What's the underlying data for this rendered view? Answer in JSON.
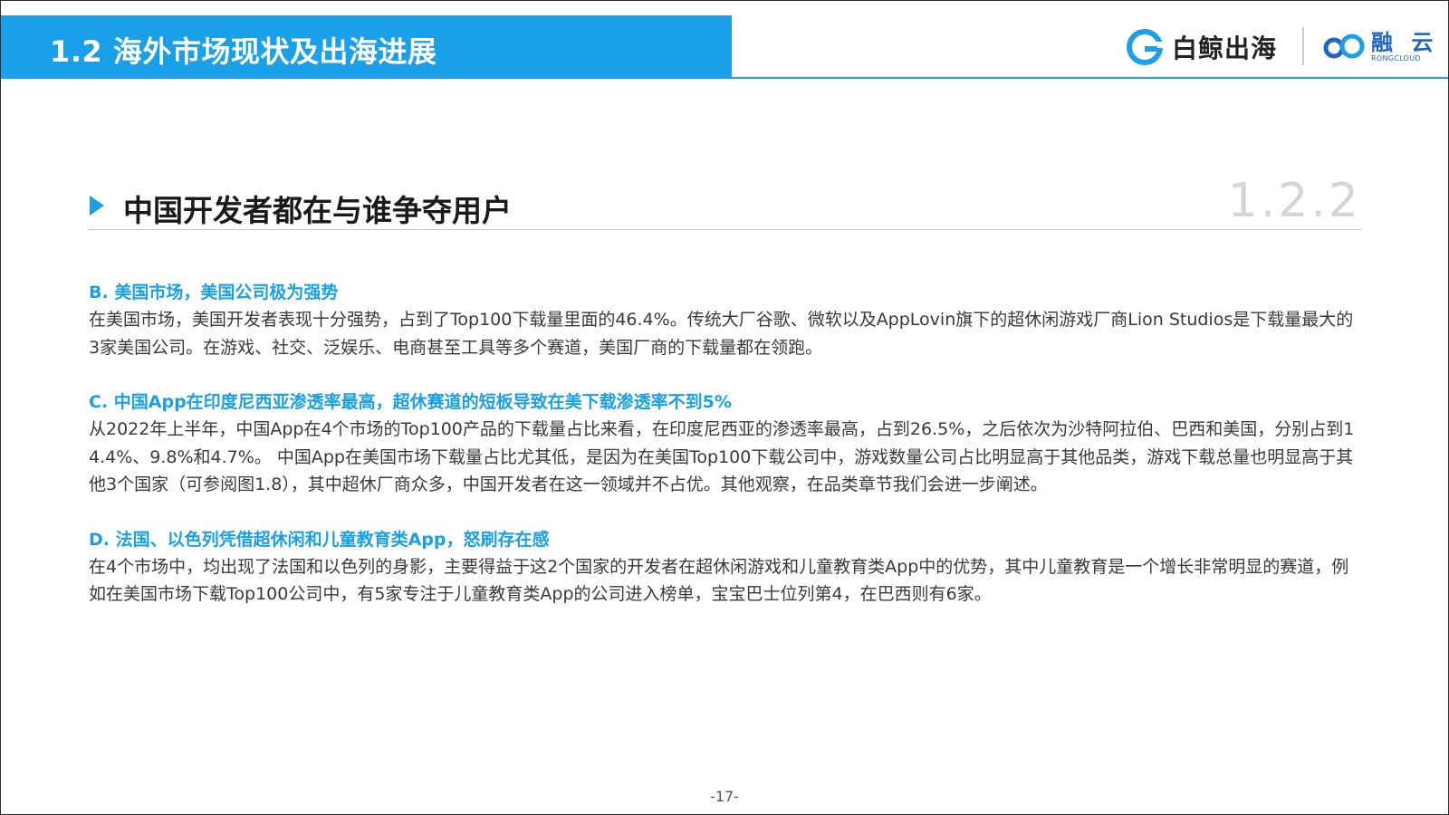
{
  "header": {
    "title": "1.2 海外市场现状及出海进展",
    "logo_baijing": "白鲸出海",
    "logo_rongcloud_cn": "融 云",
    "logo_rongcloud_en": "RONGCLOUD"
  },
  "section": {
    "title": "中国开发者都在与谁争夺用户",
    "number": "1.2.2"
  },
  "blocks": [
    {
      "heading": "B. 美国市场，美国公司极为强势",
      "body": "在美国市场，美国开发者表现十分强势，占到了Top100下载量里面的46.4%。传统大厂谷歌、微软以及AppLovin旗下的超休闲游戏厂商Lion Studios是下载量最大的3家美国公司。在游戏、社交、泛娱乐、电商甚至工具等多个赛道，美国厂商的下载量都在领跑。"
    },
    {
      "heading": "C. 中国App在印度尼西亚渗透率最高，超休赛道的短板导致在美下载渗透率不到5%",
      "body": "从2022年上半年，中国App在4个市场的Top100产品的下载量占比来看，在印度尼西亚的渗透率最高，占到26.5%，之后依次为沙特阿拉伯、巴西和美国，分别占到14.4%、9.8%和4.7%。 中国App在美国市场下载量占比尤其低，是因为在美国Top100下载公司中，游戏数量公司占比明显高于其他品类，游戏下载总量也明显高于其他3个国家（可参阅图1.8），其中超休厂商众多，中国开发者在这一领域并不占优。其他观察，在品类章节我们会进一步阐述。"
    },
    {
      "heading": "D. 法国、以色列凭借超休闲和儿童教育类App，怒刷存在感",
      "body": "在4个市场中，均出现了法国和以色列的身影，主要得益于这2个国家的开发者在超休闲游戏和儿童教育类App中的优势，其中儿童教育是一个增长非常明显的赛道，例如在美国市场下载Top100公司中，有5家专注于儿童教育类App的公司进入榜单，宝宝巴士位列第4，在巴西则有6家。"
    }
  ],
  "footer": {
    "page_number": "-17-"
  },
  "colors": {
    "accent": "#1aa0e9",
    "rongcloud_blue": "#1f66c8",
    "section_number_gray": "#d6d6d6"
  }
}
